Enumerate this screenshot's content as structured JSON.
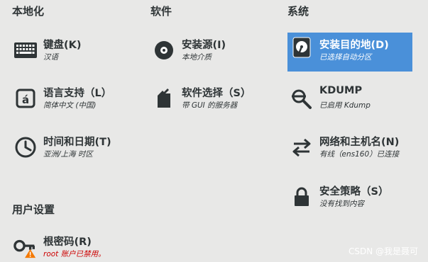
{
  "sections": {
    "localization": "本地化",
    "software": "软件",
    "system": "系统",
    "user_settings": "用户设置"
  },
  "spokes": {
    "keyboard": {
      "label": "键盘(K)",
      "status": "汉语",
      "icon": "keyboard-icon"
    },
    "language": {
      "label": "语言支持（L）",
      "status": "简体中文 (中国)",
      "icon": "language-icon"
    },
    "datetime": {
      "label": "时间和日期(T)",
      "status": "亚洲/上海 时区",
      "icon": "clock-icon"
    },
    "source": {
      "label": "安装源(I)",
      "status": "本地介质",
      "icon": "disc-icon"
    },
    "software_selection": {
      "label": "软件选择（S）",
      "status": "带 GUI 的服务器",
      "icon": "package-icon"
    },
    "destination": {
      "label": "安装目的地(D)",
      "status": "已选择自动分区",
      "icon": "harddisk-icon",
      "selected": true
    },
    "kdump": {
      "label": "KDUMP",
      "status": "已启用 Kdump",
      "icon": "magnifier-icon"
    },
    "network": {
      "label": "网络和主机名(N)",
      "status": "有线（ens160）已连接",
      "icon": "network-arrows-icon"
    },
    "security": {
      "label": "安全策略（S）",
      "status": "没有找到内容",
      "icon": "lock-icon"
    },
    "root_password": {
      "label": "根密码(R)",
      "status": "root 账户已禁用。",
      "icon": "key-warning-icon",
      "warning": true
    }
  },
  "watermark": "CSDN @我是聂可",
  "colors": {
    "background": "#e8e8e7",
    "selected": "#4a90d9",
    "warning_text": "#cc0000",
    "warning_icon": "#f57900"
  }
}
